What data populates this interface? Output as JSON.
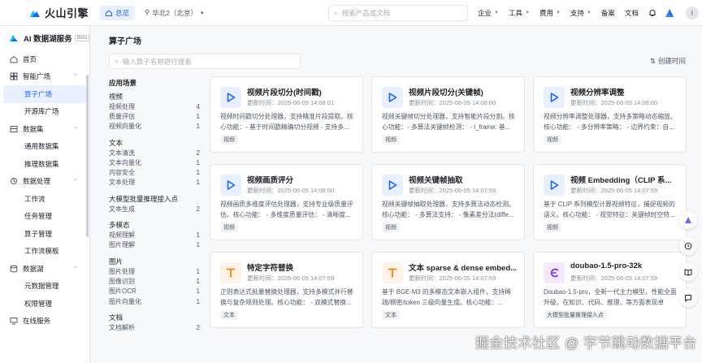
{
  "header": {
    "brand": "火山引擎",
    "home_label": "总览",
    "region": "华北2（北京）",
    "search_placeholder": "搜索产品或文档",
    "nav": [
      {
        "label": "企业",
        "has_menu": true
      },
      {
        "label": "工具",
        "has_menu": true
      },
      {
        "label": "费用",
        "has_menu": true
      },
      {
        "label": "支持",
        "has_menu": true
      },
      {
        "label": "备案",
        "has_menu": false
      },
      {
        "label": "文档",
        "has_menu": false
      }
    ],
    "avatar_initial": "I"
  },
  "sidebar": {
    "title": "AI 数据湖服务",
    "badge": "Beta",
    "items": [
      {
        "type": "item",
        "label": "首页",
        "icon": "home-icon"
      },
      {
        "type": "group",
        "label": "智能广场",
        "icon": "grid-icon",
        "expanded": true
      },
      {
        "type": "sub",
        "label": "算子广场",
        "active": true
      },
      {
        "type": "sub",
        "label": "开源库广场"
      },
      {
        "type": "group",
        "label": "数据集",
        "icon": "dataset-icon",
        "expanded": true
      },
      {
        "type": "sub",
        "label": "通用数据集"
      },
      {
        "type": "sub",
        "label": "推理数据集"
      },
      {
        "type": "group",
        "label": "数据处理",
        "icon": "process-icon",
        "expanded": true
      },
      {
        "type": "sub",
        "label": "工作流"
      },
      {
        "type": "sub",
        "label": "任务管理"
      },
      {
        "type": "sub",
        "label": "算子管理"
      },
      {
        "type": "sub",
        "label": "工作流模板"
      },
      {
        "type": "group",
        "label": "数据湖",
        "icon": "database-icon",
        "expanded": true
      },
      {
        "type": "sub",
        "label": "元数据管理"
      },
      {
        "type": "sub",
        "label": "权限管理"
      },
      {
        "type": "item",
        "label": "在线服务",
        "icon": "service-icon"
      }
    ]
  },
  "main": {
    "title": "算子广场",
    "search_placeholder": "输入算子名称进行搜索",
    "sort_label": "创建时间",
    "filters": {
      "heading": "应用场景",
      "groups": [
        {
          "title": "视频",
          "rows": [
            {
              "label": "视频处理",
              "count": "4"
            },
            {
              "label": "质量评估",
              "count": "1"
            },
            {
              "label": "视频向量化",
              "count": "1"
            }
          ]
        },
        {
          "title": "文本",
          "rows": [
            {
              "label": "文本清洗",
              "count": "2"
            },
            {
              "label": "文本向量化",
              "count": "1"
            },
            {
              "label": "内容安全",
              "count": "1"
            },
            {
              "label": "文本处理",
              "count": "1"
            }
          ]
        },
        {
          "title": "大模型批量推理接入点",
          "rows": [
            {
              "label": "文本生成",
              "count": "2"
            }
          ]
        },
        {
          "title": "多模态",
          "rows": [
            {
              "label": "视频理解",
              "count": "1"
            },
            {
              "label": "图片理解",
              "count": "1"
            }
          ]
        },
        {
          "title": "图片",
          "rows": [
            {
              "label": "图片处理",
              "count": "1"
            },
            {
              "label": "图像识别",
              "count": "1"
            },
            {
              "label": "图片OCR",
              "count": "1"
            },
            {
              "label": "图片向量化",
              "count": "1"
            }
          ]
        },
        {
          "title": "文档",
          "rows": [
            {
              "label": "文档解析",
              "count": "2"
            }
          ]
        }
      ]
    },
    "cards": [
      {
        "title": "视频片段切分(时间戳)",
        "meta": "更新时间：2025-06-05 14:08:01",
        "desc": "视频时间戳切分处理器，支持精准片段提取。核心功能：- 基于时间戳精确切分视频 - 支持多...",
        "tag": "视频",
        "icon": "play-icon",
        "color": "#1664ff",
        "bg": "#e8f0ff",
        "glyph": "▷"
      },
      {
        "title": "视频片段切分(关键帧)",
        "meta": "更新时间：2025-06-05 14:08:00",
        "desc": "视频关键帧切分处理器，支持智能片段分割。核心功能：- 多算法关键帧检测： - I_frame: 基...",
        "tag": "视频",
        "icon": "play-icon",
        "color": "#1664ff",
        "bg": "#e8f0ff",
        "glyph": "▷"
      },
      {
        "title": "视频分辨率调整",
        "meta": "更新时间：2025-06-05 14:08:00",
        "desc": "视频分辨率调整处理器，支持多策略动态缩放。核心功能： - 多分辨率策略： - 边界约束：自...",
        "tag": "视频",
        "icon": "play-icon",
        "color": "#1664ff",
        "bg": "#e8f0ff",
        "glyph": "▷"
      },
      {
        "title": "视频画质评分",
        "meta": "更新时间：2025-06-05 14:08:00",
        "desc": "视频画质多维度评估处理器，支持专业级质量评估。核心功能： - 多维度质量评估： - 清晰度...",
        "tag": "视频",
        "icon": "play-icon",
        "color": "#1664ff",
        "bg": "#e8f0ff",
        "glyph": "▷"
      },
      {
        "title": "视频关键帧抽取",
        "meta": "更新时间：2025-06-05 14:07:59",
        "desc": "视频关键帧抽取处理器，支持多算法动态检测。核心功能： - 多算法支持： - 像素差分法(diffe...",
        "tag": "视频",
        "icon": "play-icon",
        "color": "#1664ff",
        "bg": "#e8f0ff",
        "glyph": "▷"
      },
      {
        "title": "视频 Embedding（CLIP 系...",
        "meta": "更新时间：2025-06-05 14:07:59",
        "desc": "基于 CLIP 系列模型计算视频特征，捕捉视频的语义。核心功能： - 视觉特征：关键帧时空特...",
        "tag": "视频",
        "icon": "play-icon",
        "color": "#1664ff",
        "bg": "#e8f0ff",
        "glyph": "▷"
      },
      {
        "title": "特定字符替换",
        "meta": "更新时间：2025-06-05 14:07:59",
        "desc": "正则表达式批量替换处理器，支持多模式并行替换与复杂规则处理。核心功能： - 双模式替换...",
        "tag": "文本",
        "icon": "text-icon",
        "color": "#ff7d00",
        "bg": "#fff3e8",
        "glyph": "T"
      },
      {
        "title": "文本 sparse & dense embed...",
        "meta": "更新时间：2025-06-05 14:07:59",
        "desc": "基于 BGE-M3 的多模态文本嵌入组件，支持稀疏/稠密/token 三级向量生成。核心功能：...",
        "tag": "文本",
        "icon": "text-icon",
        "color": "#ff7d00",
        "bg": "#fff3e8",
        "glyph": "T"
      },
      {
        "title": "doubao-1.5-pro-32k",
        "meta": "更新时间：2025-06-05 14:07:59",
        "desc": "Doubao-1.5-pro，全新一代主力模型，性能全面升级，在知识、代码、推理、等方面表现卓越。...",
        "tag": "大模型批量推理接入点",
        "icon": "model-icon",
        "color": "#7b2ff7",
        "bg": "#f3e8ff",
        "glyph": "C"
      }
    ]
  },
  "watermark": "掘金技术社区 @ 字节跳动数据平台"
}
